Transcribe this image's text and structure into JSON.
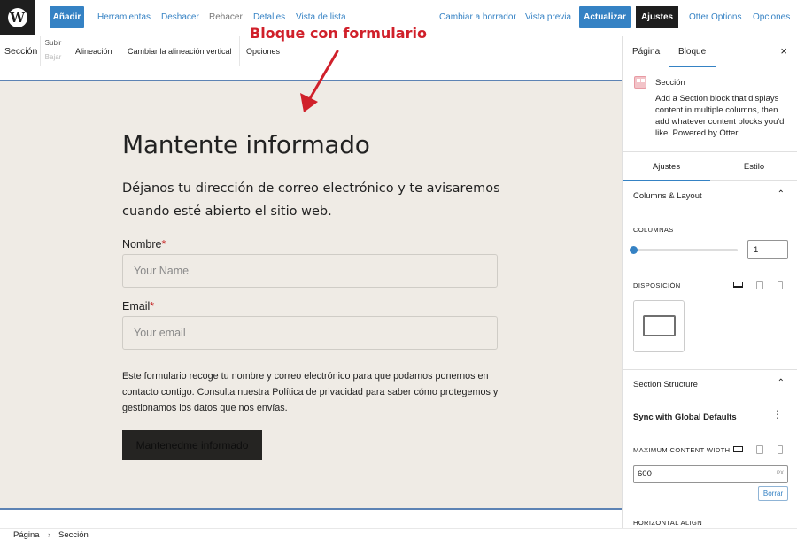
{
  "topbar": {
    "logo": "W",
    "add_label": "Añadir",
    "links_left": [
      "Herramientas",
      "Deshacer",
      "Rehacer",
      "Detalles",
      "Vista de lista"
    ],
    "draft_label": "Cambiar a borrador",
    "preview_label": "Vista previa",
    "update_label": "Actualizar",
    "settings_label": "Ajustes",
    "otter_label": "Otter Options",
    "options_label": "Opciones",
    "accent_color": "#3582c4"
  },
  "block_toolbar": {
    "block_name": "Sección",
    "move_up": "Subir",
    "move_down": "Bajar",
    "alignment": "Alineación",
    "vertical_alignment": "Cambiar la alineación vertical",
    "options": "Opciones"
  },
  "annotation": {
    "text": "Bloque con formulario",
    "color": "#d0202a"
  },
  "canvas": {
    "title": "Mantente informado",
    "intro": "Déjanos tu dirección de correo electrónico y te avisaremos cuando esté abierto el sitio web.",
    "fields": [
      {
        "label": "Nombre",
        "required_mark": "*",
        "placeholder": "Your Name"
      },
      {
        "label": "Email",
        "required_mark": "*",
        "placeholder": "Your email"
      }
    ],
    "policy": "Este formulario recoge tu nombre y correo electrónico para que podamos ponernos en contacto contigo. Consulta nuestra Política de privacidad para saber cómo protegemos y gestionamos los datos que nos envías.",
    "submit_label": "Mantenedme informado",
    "background": "#efebe5"
  },
  "sidebar": {
    "tabs": [
      "Página",
      "Bloque"
    ],
    "active_tab": "Bloque",
    "close": "×",
    "block_card": {
      "title": "Sección",
      "description": "Add a Section block that displays content in multiple columns, then add whatever content blocks you'd like. Powered by Otter."
    },
    "sub_tabs": [
      "Ajustes",
      "Estilo"
    ],
    "active_sub_tab": "Ajustes",
    "columns_layout": {
      "heading": "Columns & Layout",
      "columns_label": "COLUMNAS",
      "columns_value": "1",
      "columns_slider_fraction": 0,
      "layout_label": "DISPOSICIÓN"
    },
    "section_structure": {
      "heading": "Section Structure",
      "sync_label": "Sync with Global Defaults",
      "max_width_label": "MAXIMUM CONTENT WIDTH",
      "max_width_value": "600",
      "unit": "PX",
      "reset_label": "Borrar",
      "horizontal_align_label": "HORIZONTAL ALIGN"
    }
  },
  "footer": {
    "breadcrumb": [
      "Página",
      "Sección"
    ],
    "separator": "›"
  }
}
